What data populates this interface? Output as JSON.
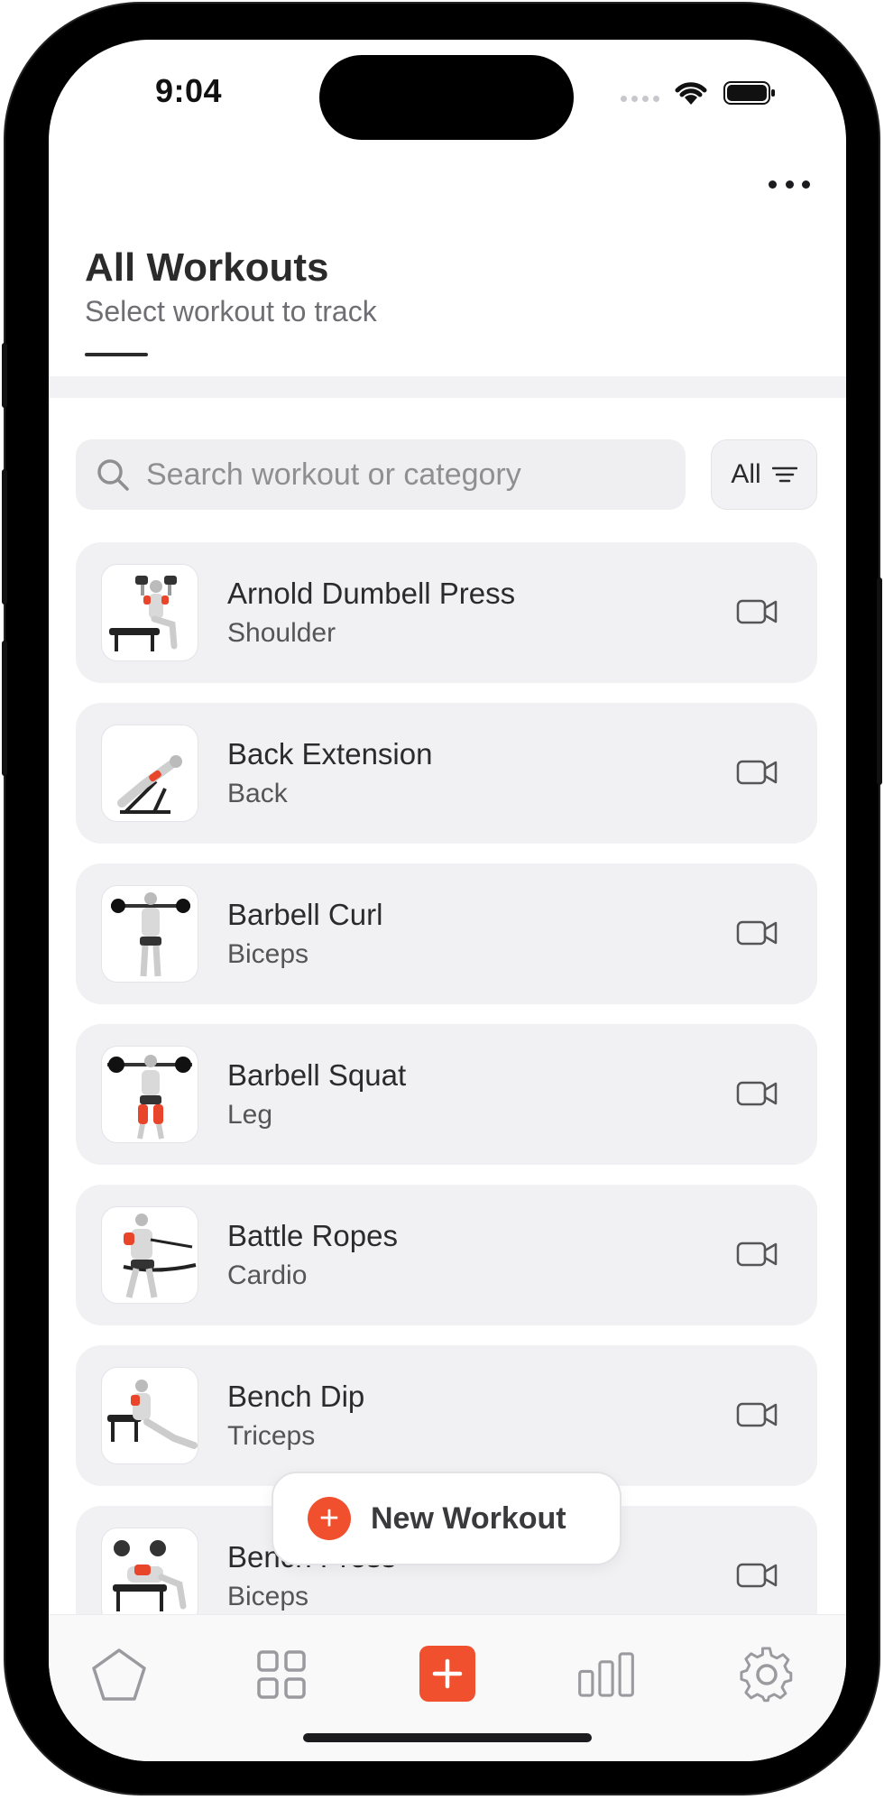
{
  "status_bar": {
    "time": "9:04"
  },
  "header": {
    "title": "All Workouts",
    "subtitle": "Select workout to track"
  },
  "search": {
    "placeholder": "Search workout or category",
    "value": ""
  },
  "filter": {
    "label": "All"
  },
  "workouts": [
    {
      "name": "Arnold Dumbell Press",
      "category": "Shoulder"
    },
    {
      "name": "Back Extension",
      "category": "Back"
    },
    {
      "name": "Barbell Curl",
      "category": "Biceps"
    },
    {
      "name": "Barbell Squat",
      "category": "Leg"
    },
    {
      "name": "Battle Ropes",
      "category": "Cardio"
    },
    {
      "name": "Bench Dip",
      "category": "Triceps"
    },
    {
      "name": "Bench Press",
      "category": "Biceps"
    }
  ],
  "fab": {
    "label": "New Workout"
  },
  "tabbar": {
    "items": [
      "home-icon",
      "grid-icon",
      "add-icon",
      "stats-icon",
      "settings-icon"
    ]
  },
  "colors": {
    "accent": "#f0502e",
    "card": "#f1f1f4",
    "text": "#2b2b2b"
  }
}
